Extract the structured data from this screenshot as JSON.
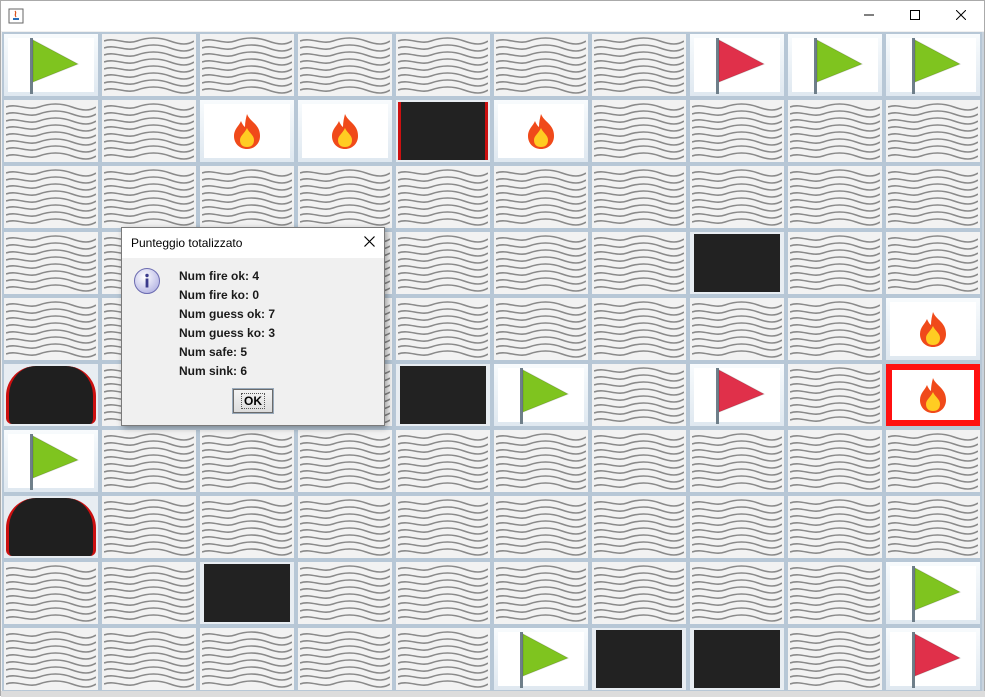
{
  "window": {
    "icon": "java-icon",
    "controls": [
      "minimize-icon",
      "maximize-icon",
      "close-icon"
    ]
  },
  "board": {
    "rows": [
      [
        "flag-green",
        "water",
        "water",
        "water",
        "water",
        "water",
        "water",
        "flag-red",
        "flag-green",
        "flag-green"
      ],
      [
        "water",
        "water",
        "fire",
        "fire",
        "black-redsides",
        "fire",
        "water",
        "water",
        "water",
        "water"
      ],
      [
        "water",
        "water",
        "water",
        "water",
        "water",
        "water",
        "water",
        "water",
        "water",
        "water"
      ],
      [
        "water",
        "water",
        "water",
        "water",
        "water",
        "water",
        "water",
        "black",
        "water",
        "water"
      ],
      [
        "water",
        "water",
        "water",
        "water",
        "water",
        "water",
        "water",
        "water",
        "water",
        "fire"
      ],
      [
        "oval",
        "water",
        "water",
        "water",
        "black",
        "flag-green",
        "water",
        "flag-red",
        "water",
        "fire-red"
      ],
      [
        "flag-green",
        "water",
        "water",
        "water",
        "water",
        "water",
        "water",
        "water",
        "water",
        "water"
      ],
      [
        "oval",
        "water",
        "water",
        "water",
        "water",
        "water",
        "water",
        "water",
        "water",
        "water"
      ],
      [
        "water",
        "water",
        "black",
        "water",
        "water",
        "water",
        "water",
        "water",
        "water",
        "flag-green"
      ],
      [
        "water",
        "water",
        "water",
        "water",
        "water",
        "flag-green",
        "black",
        "black",
        "water",
        "flag-red"
      ]
    ]
  },
  "dialog": {
    "title": "Punteggio totalizzato",
    "icon": "info-icon",
    "lines": [
      "Num fire ok: 4",
      "Num fire ko: 0",
      "Num guess ok: 7",
      "Num guess ko: 3",
      "Num safe: 5",
      "Num sink: 6"
    ],
    "ok_label": "OK"
  },
  "colors": {
    "flag_green": "#7fc41f",
    "flag_red": "#e0304a",
    "fire_outer": "#f04a1a",
    "fire_inner": "#ffcc22",
    "hit_border": "#ff1010"
  }
}
